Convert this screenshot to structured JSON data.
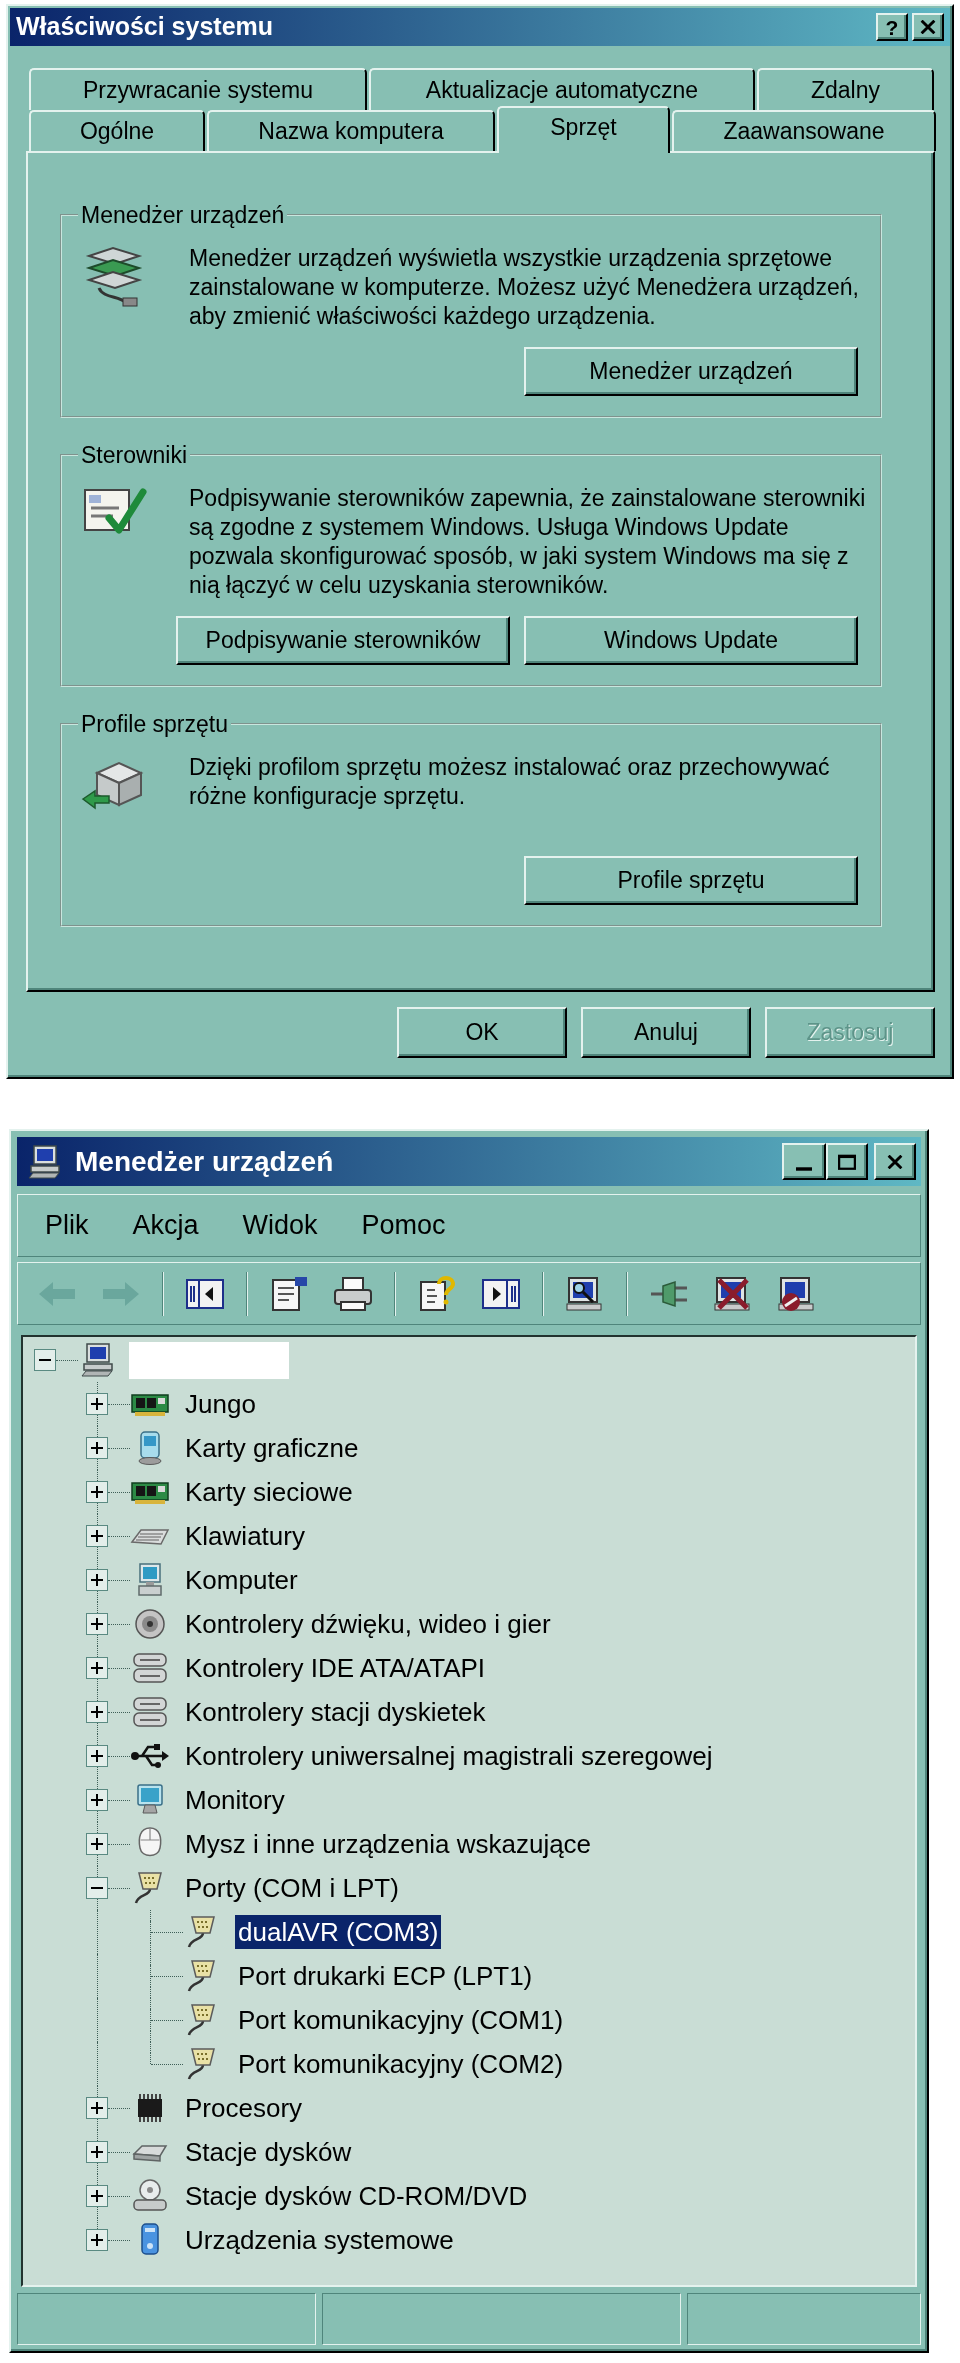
{
  "system_properties": {
    "title": "Właściwości systemu",
    "help_button": "?",
    "tab_rows": [
      [
        {
          "label": "Przywracanie systemu",
          "selected": false
        },
        {
          "label": "Aktualizacje automatyczne",
          "selected": false
        },
        {
          "label": "Zdalny",
          "selected": false
        }
      ],
      [
        {
          "label": "Ogólne",
          "selected": false
        },
        {
          "label": "Nazwa komputera",
          "selected": false
        },
        {
          "label": "Sprzęt",
          "selected": true
        },
        {
          "label": "Zaawansowane",
          "selected": false
        }
      ]
    ],
    "groups": [
      {
        "kind": "device-manager",
        "title": "Menedżer urządzeń",
        "text": "Menedżer urządzeń wyświetla wszystkie urządzenia sprzętowe zainstalowane w komputerze. Możesz użyć Menedżera urządzeń, aby zmienić właściwości każdego urządzenia.",
        "buttons": [
          "Menedżer urządzeń"
        ]
      },
      {
        "kind": "drivers",
        "title": "Sterowniki",
        "text": "Podpisywanie sterowników zapewnia, że zainstalowane sterowniki są zgodne z systemem Windows. Usługa Windows Update pozwala skonfigurować sposób, w jaki system Windows ma się z nią łączyć w celu uzyskania sterowników.",
        "buttons": [
          "Podpisywanie sterowników",
          "Windows Update"
        ]
      },
      {
        "kind": "hardware-profiles",
        "title": "Profile sprzętu",
        "text": "Dzięki profilom sprzętu możesz instalować oraz przechowywać różne konfiguracje sprzętu.",
        "buttons": [
          "Profile sprzętu"
        ]
      }
    ],
    "buttons": [
      {
        "label": "OK",
        "disabled": false
      },
      {
        "label": "Anuluj",
        "disabled": false
      },
      {
        "label": "Zastosuj",
        "disabled": true
      }
    ]
  },
  "device_manager": {
    "title": "Menedżer urządzeń",
    "menu": [
      "Plik",
      "Akcja",
      "Widok",
      "Pomoc"
    ],
    "toolbar": [
      [
        {
          "kind": "back",
          "disabled": true
        },
        {
          "kind": "forward",
          "disabled": true
        }
      ],
      [
        {
          "kind": "tree-pane",
          "disabled": false
        }
      ],
      [
        {
          "kind": "properties",
          "disabled": false
        },
        {
          "kind": "print",
          "disabled": false
        }
      ],
      [
        {
          "kind": "help",
          "disabled": false
        },
        {
          "kind": "action-pane",
          "disabled": false
        }
      ],
      [
        {
          "kind": "scan",
          "disabled": false
        }
      ],
      [
        {
          "kind": "update",
          "disabled": false
        },
        {
          "kind": "uninstall",
          "disabled": false
        },
        {
          "kind": "disable",
          "disabled": false
        }
      ]
    ],
    "tree": {
      "kind": "pc",
      "expanded": true,
      "selected": false,
      "children": [
        {
          "kind": "board",
          "label": "Jungo",
          "expanded": false,
          "selected": false
        },
        {
          "kind": "display",
          "label": "Karty graficzne",
          "expanded": false,
          "selected": false
        },
        {
          "kind": "board",
          "label": "Karty sieciowe",
          "expanded": false,
          "selected": false
        },
        {
          "kind": "keyboard",
          "label": "Klawiatury",
          "expanded": false,
          "selected": false
        },
        {
          "kind": "computer",
          "label": "Komputer",
          "expanded": false,
          "selected": false
        },
        {
          "kind": "speaker",
          "label": "Kontrolery dźwięku, wideo i gier",
          "expanded": false,
          "selected": false
        },
        {
          "kind": "drives",
          "label": "Kontrolery IDE ATA/ATAPI",
          "expanded": false,
          "selected": false
        },
        {
          "kind": "drives",
          "label": "Kontrolery stacji dyskietek",
          "expanded": false,
          "selected": false
        },
        {
          "kind": "usb",
          "label": "Kontrolery uniwersalnej magistrali szeregowej",
          "expanded": false,
          "selected": false
        },
        {
          "kind": "monitor",
          "label": "Monitory",
          "expanded": false,
          "selected": false
        },
        {
          "kind": "mouse",
          "label": "Mysz i inne urządzenia wskazujące",
          "expanded": false,
          "selected": false
        },
        {
          "kind": "port",
          "label": "Porty (COM i LPT)",
          "expanded": true,
          "selected": false,
          "children": [
            {
              "kind": "port",
              "label": "dualAVR (COM3)",
              "selected": true
            },
            {
              "kind": "port",
              "label": "Port drukarki ECP (LPT1)",
              "selected": false
            },
            {
              "kind": "port",
              "label": "Port komunikacyjny (COM1)",
              "selected": false
            },
            {
              "kind": "port",
              "label": "Port komunikacyjny (COM2)",
              "selected": false
            }
          ]
        },
        {
          "kind": "cpu",
          "label": "Procesory",
          "expanded": false,
          "selected": false
        },
        {
          "kind": "disk",
          "label": "Stacje dysków",
          "expanded": false,
          "selected": false
        },
        {
          "kind": "cdrom",
          "label": "Stacje dysków CD-ROM/DVD",
          "expanded": false,
          "selected": false
        },
        {
          "kind": "system",
          "label": "Urządzenia systemowe",
          "expanded": false,
          "selected": false
        }
      ]
    }
  }
}
